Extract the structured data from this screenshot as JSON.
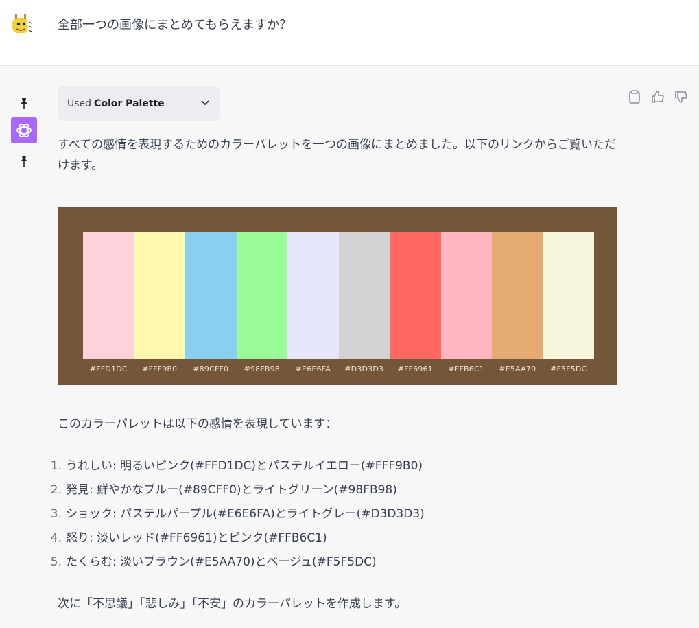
{
  "user_message": "全部一つの画像にまとめてもらえますか？",
  "plugin": {
    "used_prefix": "Used",
    "name": "Color Palette"
  },
  "assistant": {
    "intro": "すべての感情を表現するためのカラーパレットを一つの画像にまとめました。以下のリンクからご覧いただけます。",
    "palette_heading": "このカラーパレットは以下の感情を表現しています：",
    "emotions": [
      {
        "num": "1.",
        "text": "うれしい: 明るいピンク(#FFD1DC)とパステルイエロー(#FFF9B0)"
      },
      {
        "num": "2.",
        "text": "発見: 鮮やかなブルー(#89CFF0)とライトグリーン(#98FB98)"
      },
      {
        "num": "3.",
        "text": "ショック: パステルパープル(#E6E6FA)とライトグレー(#D3D3D3)"
      },
      {
        "num": "4.",
        "text": "怒り: 淡いレッド(#FF6961)とピンク(#FFB6C1)"
      },
      {
        "num": "5.",
        "text": "たくらむ: 淡いブラウン(#E5AA70)とベージュ(#F5F5DC)"
      }
    ],
    "closing": "次に「不思議」「悲しみ」「不安」のカラーパレットを作成します。"
  },
  "palette": {
    "background": "#745638",
    "swatches": [
      {
        "label": "#FFD1DC",
        "color": "#FFD1DC"
      },
      {
        "label": "#FFF9B0",
        "color": "#FFF9B0"
      },
      {
        "label": "#89CFF0",
        "color": "#89CFF0"
      },
      {
        "label": "#98FB98",
        "color": "#98FB98"
      },
      {
        "label": "#E6E6FA",
        "color": "#E6E6FA"
      },
      {
        "label": "#D3D3D3",
        "color": "#D3D3D3"
      },
      {
        "label": "#FF6961",
        "color": "#FF6961"
      },
      {
        "label": "#FFB6C1",
        "color": "#FFB6C1"
      },
      {
        "label": "#E5AA70",
        "color": "#E5AA70"
      },
      {
        "label": "#F5F5DC",
        "color": "#F5F5DC"
      }
    ]
  },
  "icons": {
    "user_avatar": "giraffe-avatar-icon",
    "assistant_avatar": "openai-logo-icon",
    "pin": "pushpin-icon",
    "dropdown": "chevron-down-icon",
    "copy": "clipboard-icon",
    "like": "thumbs-up-icon",
    "dislike": "thumbs-down-icon"
  }
}
